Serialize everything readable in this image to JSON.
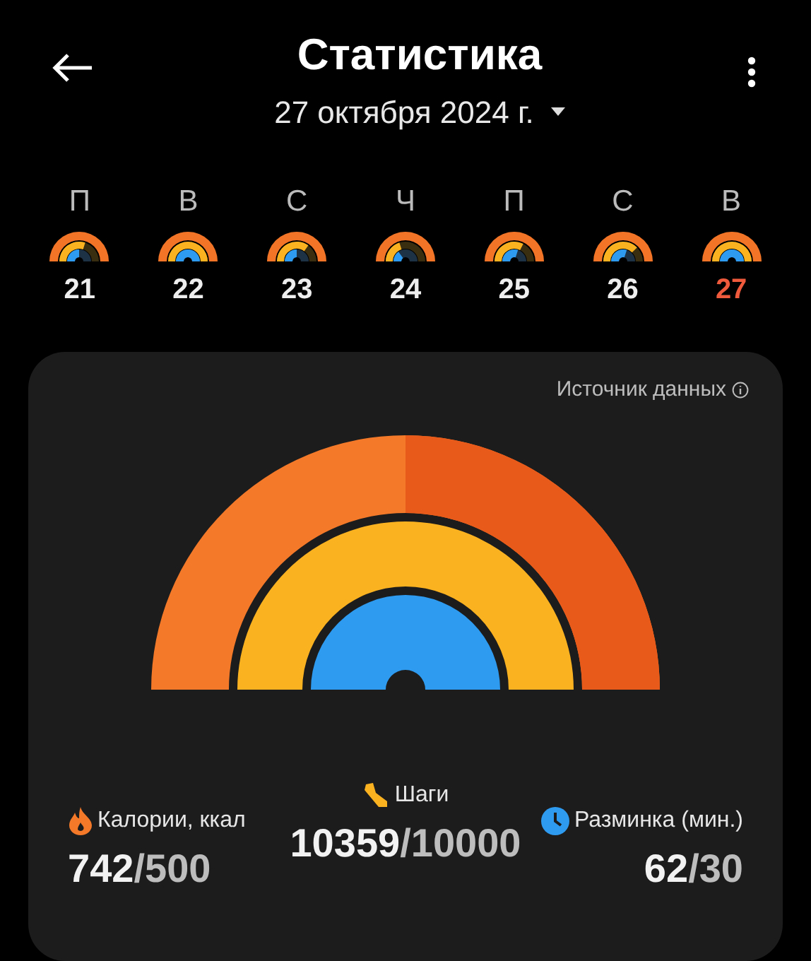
{
  "header": {
    "title": "Статистика",
    "date": "27 октября 2024 г."
  },
  "week": [
    {
      "weekday": "П",
      "day": "21",
      "selected": false
    },
    {
      "weekday": "В",
      "day": "22",
      "selected": false
    },
    {
      "weekday": "С",
      "day": "23",
      "selected": false
    },
    {
      "weekday": "Ч",
      "day": "24",
      "selected": false
    },
    {
      "weekday": "П",
      "day": "25",
      "selected": false
    },
    {
      "weekday": "С",
      "day": "26",
      "selected": false
    },
    {
      "weekday": "В",
      "day": "27",
      "selected": true
    }
  ],
  "card": {
    "source_label": "Источник данных",
    "metrics": [
      {
        "kind": "calories",
        "label": "Калории, ккал",
        "value": "742",
        "goal": "/500",
        "color": "#f47a2a"
      },
      {
        "kind": "steps",
        "label": "Шаги",
        "value": "10359",
        "goal": "/10000",
        "color": "#fbb220"
      },
      {
        "kind": "exercise",
        "label": "Разминка (мин.)",
        "value": "62",
        "goal": "/30",
        "color": "#2f9bf0"
      }
    ]
  }
}
